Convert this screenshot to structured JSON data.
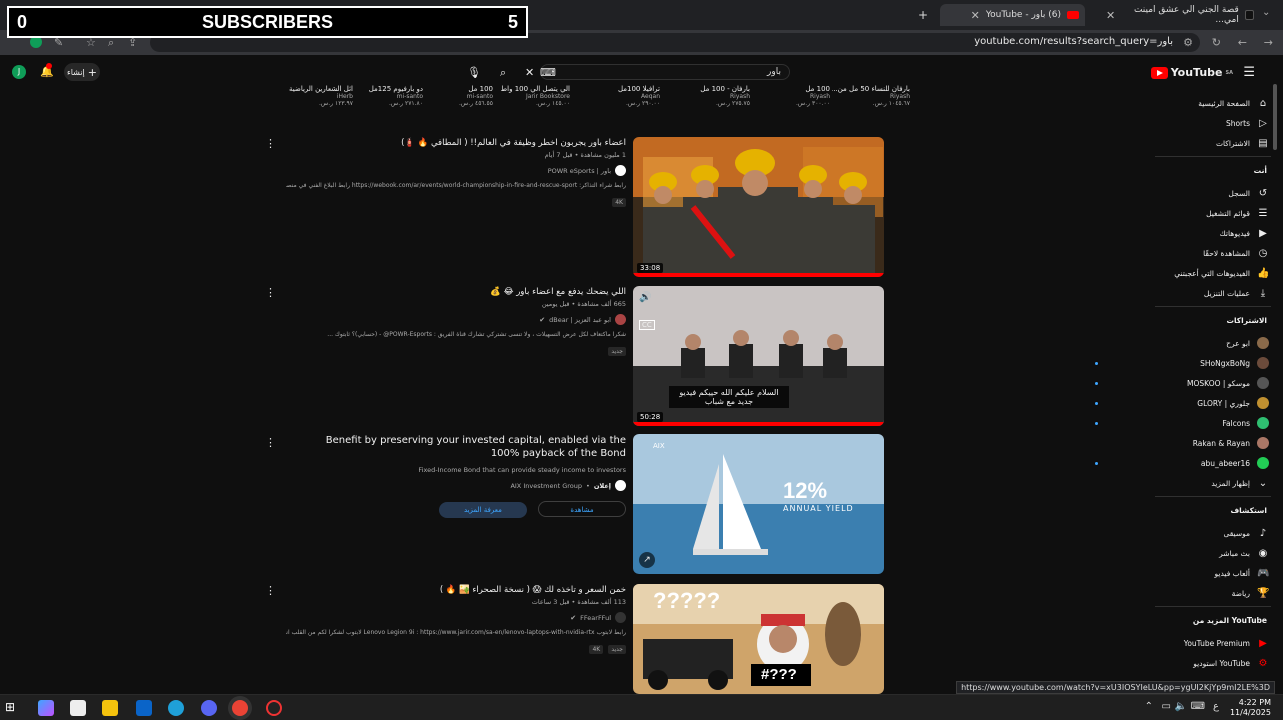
{
  "overlay": {
    "left_value": "0",
    "label": "SUBSCRIBERS",
    "right_value": "5"
  },
  "browser": {
    "tabs": [
      {
        "title": "قصة الجني الي عشق امينت امي...",
        "icon": "tiktok-icon"
      },
      {
        "title": "(6) باور - YouTube",
        "icon": "youtube-icon"
      }
    ],
    "url": "youtube.com/results?search_query=باور",
    "status_url": "https://www.youtube.com/watch?v=xU3IOSYIeLU&pp=ygUI2KjYp9mI2LE%3D"
  },
  "youtube": {
    "logo": "YouTube",
    "logo_sup": "SA",
    "search_value": "باور",
    "create_label": "إنشاء",
    "avatar_letter": "J"
  },
  "shopping": [
    {
      "title": "بارفان للنساء 50 مل من...",
      "store": "Riyash",
      "price": "١٠٤٥.٦٧ ر.س."
    },
    {
      "title": "100 مل",
      "store": "Riyash",
      "price": "٣٠٠.٠٠ ر.س."
    },
    {
      "title": "بارفان - 100 مل",
      "store": "Riyash",
      "price": "٢٧٥.٧٥ ر.س."
    },
    {
      "title": "ترافيلا 100مل",
      "store": "Aeqan",
      "price": "٢٩٠.٠٠ ر.س."
    },
    {
      "title": "الي يتصل الي 100 واط",
      "store": "Jarir Bookstore",
      "price": "١٤٥.٠٠ ر.س."
    },
    {
      "title": "100 مل",
      "store": "mi-santo",
      "price": "٤٥٦.٥٥ ر.س."
    },
    {
      "title": "دو بارفيوم 125مل",
      "store": "mi-santo",
      "price": "٢٧١.٨٠ ر.س."
    },
    {
      "title": "اثل الشعارين الرياضية",
      "store": "iHerb",
      "price": "١٢٣.٩٧ ر.س."
    }
  ],
  "sidebar": {
    "main": [
      {
        "label": "الصفحة الرئيسية",
        "icon": "home-icon"
      },
      {
        "label": "Shorts",
        "icon": "shorts-icon"
      },
      {
        "label": "الاشتراكات",
        "icon": "subscriptions-icon"
      }
    ],
    "you_header": "أنت",
    "you": [
      {
        "label": "السجل",
        "icon": "history-icon"
      },
      {
        "label": "قوائم التشغيل",
        "icon": "playlists-icon"
      },
      {
        "label": "فيديوهاتك",
        "icon": "your-videos-icon"
      },
      {
        "label": "المشاهدة لاحقًا",
        "icon": "watch-later-icon"
      },
      {
        "label": "الفيديوهات التي أعجبتني",
        "icon": "like-icon"
      },
      {
        "label": "عمليات التنزيل",
        "icon": "download-icon"
      }
    ],
    "subs_header": "الاشتراكات",
    "subs": [
      {
        "label": "ابو عرح",
        "color": "#8a6a4a",
        "dot": false
      },
      {
        "label": "SHoNgxBoNg",
        "color": "#6b4b3b",
        "dot": true
      },
      {
        "label": "MOSKOO | موسكو",
        "color": "#555555",
        "dot": true
      },
      {
        "label": "GLORY | جلوري",
        "color": "#c09030",
        "dot": true
      },
      {
        "label": "Falcons",
        "color": "#2fbf71",
        "dot": true
      },
      {
        "label": "Rakan & Rayan",
        "color": "#aa7766",
        "dot": false
      },
      {
        "label": "abu_abeer16",
        "color": "#22cc55",
        "dot": true
      }
    ],
    "show_more": "إظهار المزيد",
    "explore_header": "استكشاف",
    "explore": [
      {
        "label": "موسيقى",
        "icon": "music-icon"
      },
      {
        "label": "بث مباشر",
        "icon": "live-icon"
      },
      {
        "label": "ألعاب فيديو",
        "icon": "gaming-icon"
      },
      {
        "label": "رياضة",
        "icon": "sports-icon"
      }
    ],
    "more_header": "المزيد من YouTube",
    "more": [
      {
        "label": "YouTube Premium",
        "icon": "premium-icon"
      },
      {
        "label": "استوديو YouTube",
        "icon": "studio-icon"
      }
    ]
  },
  "results": [
    {
      "title": "اعضاء باور يجربون اخطر وظيفة في العالم!! ( المطافي 🔥 🧯)",
      "meta": "1 مليون مشاهدة • قبل 7 أيام",
      "channel": "باور | POWR eSports",
      "desc": "رابط شراء التذاكر: https://webook.com/ar/events/world-championship-in-fire-and-rescue-sport رابط البلاغ الفني في منصة X ...",
      "badge": "4K",
      "duration": "33:08"
    },
    {
      "title": "اللي يضحك يدفع مع اعضاء باور 😂 💰",
      "meta": "665 ألف مشاهدة • قبل يومين",
      "channel": "ابو عبد العزيز | dBear",
      "desc": "شكراً ماكتعاف لكل عرض التسهيلات ، ولا تنسى تشتركي تشارك قناة الفريق : POWR-Esports@ - (حسابي)؟ ثابتوك ...",
      "badge": "جديد",
      "duration": "50:28",
      "caption": "السلام عليكم الله حييكم فيديو جديد مع شباب"
    },
    {
      "title": "Benefit by preserving your invested capital, enabled via the 100% payback of the Bond",
      "desc": "Fixed-Income Bond that can provide steady income to investors",
      "channel": "AIX Investment Group",
      "sponsored": "إعلان",
      "btn_primary": "معرفة المزيد",
      "btn_secondary": "مشاهدة",
      "thumb_big": "12%",
      "thumb_small": "ANNUAL YIELD"
    },
    {
      "title": "خمن السعر و تاخذه لك 😱 ( نسخة الصحراء 🏜️ 🔥 )",
      "meta": "113 ألف مشاهدة • قبل 3 ساعات",
      "channel": "FFearFFul",
      "desc": "رابط لابتوب Lenovo Legion 9i : https://www.jarir.com/sa-en/lenovo-laptops-with-nvidia-rtx لابتوب لشكرا لكم من القلب انتم الداعم الاول لي...",
      "badge": "4K",
      "badge2": "جديد",
      "thumb_text": "?????",
      "thumb_text2": "#???"
    }
  ],
  "taskbar": {
    "time": "4:22 PM",
    "date": "11/4/2025",
    "lang": "ع"
  }
}
